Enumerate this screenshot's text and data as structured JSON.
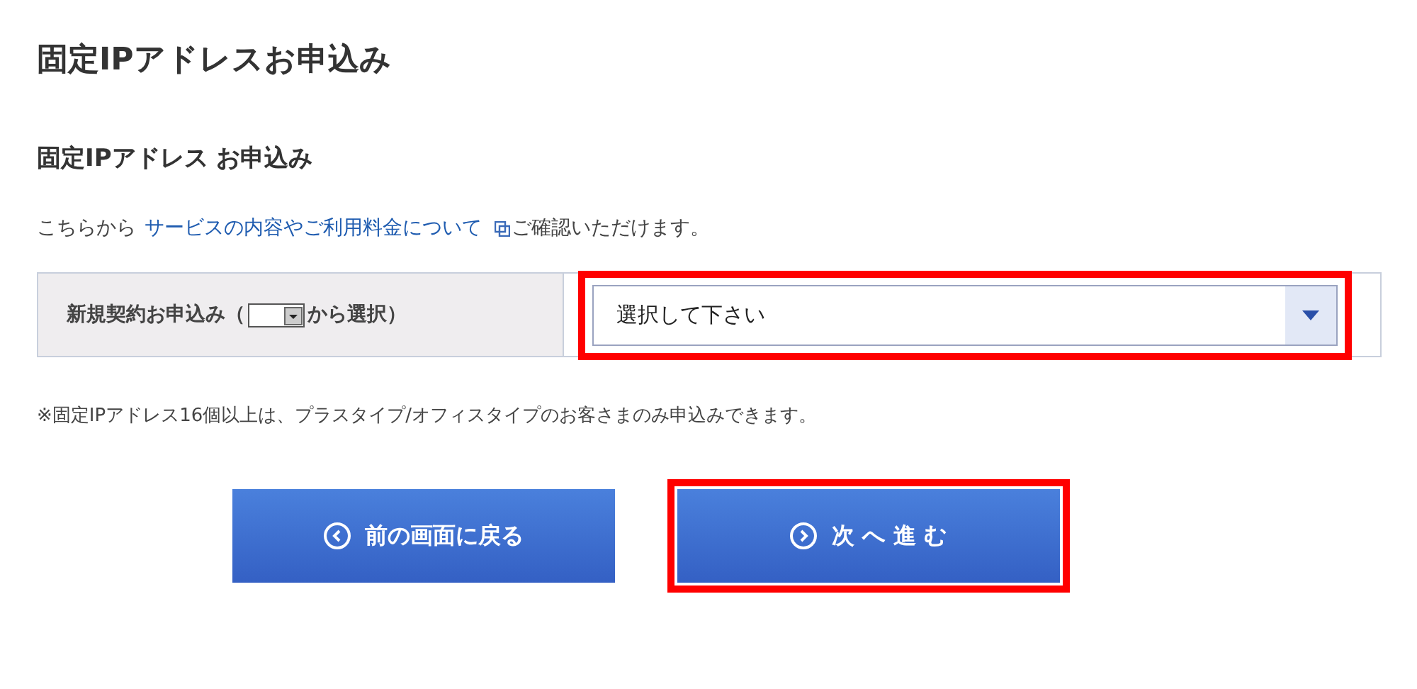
{
  "title": "固定IPアドレスお申込み",
  "section_title": "固定IPアドレス お申込み",
  "intro": {
    "before": "こちらから",
    "link": "サービスの内容やご利用料金について",
    "after": "ご確認いただけます。"
  },
  "form_row": {
    "label_before": "新規契約お申込み（",
    "label_after": "から選択）",
    "select": {
      "value": "選択して下さい",
      "highlighted": true
    }
  },
  "note": "※固定IPアドレス16個以上は、プラスタイプ/オフィスタイプのお客さまのみ申込みできます。",
  "buttons": [
    {
      "kind": "back",
      "label": "前の画面に戻る",
      "highlighted": false
    },
    {
      "kind": "next",
      "label": "次 へ 進 む",
      "highlighted": true
    }
  ]
}
